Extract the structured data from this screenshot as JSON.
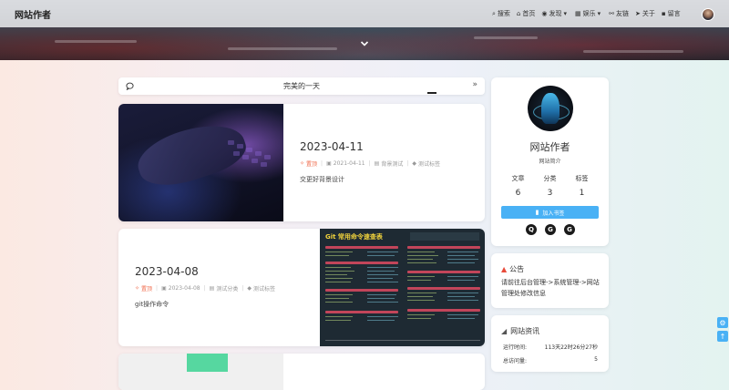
{
  "header": {
    "site_title": "网站作者",
    "menu": [
      {
        "icon": "search-icon",
        "glyph": "⌕",
        "label": "搜索"
      },
      {
        "icon": "home-icon",
        "glyph": "⌂",
        "label": "首页"
      },
      {
        "icon": "compass-icon",
        "glyph": "◉",
        "label": "发现",
        "caret": "▾"
      },
      {
        "icon": "grid-icon",
        "glyph": "▦",
        "label": "娱乐",
        "caret": "▾"
      },
      {
        "icon": "link-icon",
        "glyph": "⚯",
        "label": "友链"
      },
      {
        "icon": "paper-plane-icon",
        "glyph": "➤",
        "label": "关于"
      },
      {
        "icon": "comment-icon",
        "glyph": "▪",
        "label": "留言"
      }
    ]
  },
  "bulletin": {
    "text": "完美的一天",
    "more": "»"
  },
  "posts": [
    {
      "title": "2023-04-11",
      "pinned": "置顶",
      "date": "2021-04-11",
      "category": "背景测试",
      "tag": "测试标签",
      "desc": "交更好背景设计"
    },
    {
      "title": "2023-04-08",
      "pinned": "置顶",
      "date": "2023-04-08",
      "category": "测试分类",
      "tag": "测试标签",
      "desc": "git操作命令",
      "thumb_title": "Git 常用命令速查表"
    }
  ],
  "profile": {
    "name": "网站作者",
    "intro": "网站简介",
    "stats": [
      {
        "label": "文章",
        "value": "6"
      },
      {
        "label": "分类",
        "value": "3"
      },
      {
        "label": "标签",
        "value": "1"
      }
    ],
    "bookmark_label": "加入书签",
    "socials": [
      {
        "icon": "qq-icon",
        "glyph": "Q"
      },
      {
        "icon": "github-icon",
        "glyph": "G"
      },
      {
        "icon": "gitee-icon",
        "glyph": "G"
      }
    ]
  },
  "notice": {
    "title": "公告",
    "text": "请前往后台管理->系统管理->网站管理处修改信息"
  },
  "site_info": {
    "title": "网站资讯",
    "rows": [
      {
        "label": "运行时间:",
        "value": "113天22时26分27秒"
      },
      {
        "label": "总访问量:",
        "value": "5"
      }
    ]
  },
  "colors": {
    "accent": "#49b1f5",
    "pin": "#f06a4a",
    "bell": "#e84a3a"
  }
}
